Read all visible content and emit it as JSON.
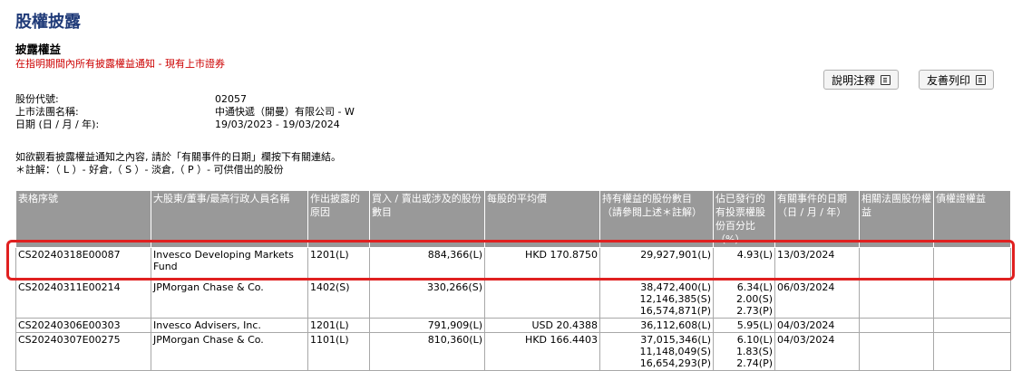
{
  "page": {
    "title": "股權披露",
    "subtitle": "披露權益",
    "notice": "在指明期間內所有披露權益通知 - 現有上市證券"
  },
  "toolbar": {
    "explain_label": "說明注釋",
    "print_label": "友善列印"
  },
  "info": [
    {
      "label": "股份代號:",
      "value": "02057"
    },
    {
      "label": "上市法團名稱:",
      "value": "中通快遞（開曼）有限公司 - W"
    },
    {
      "label": "日期 (日 / 月 / 年):",
      "value": "19/03/2023 - 19/03/2024"
    }
  ],
  "hint": {
    "line1": "如欲觀看披露權益通知之內容, 請於「有關事件的日期」欄按下有關連結。",
    "line2": "＊註解：（ L ）- 好倉,（ S ）- 淡倉,（ P ）- 可供借出的股份"
  },
  "table": {
    "headers": [
      "表格序號",
      "大股東/董事/最高行政人員名稱",
      "作出披露的原因",
      "買入 / 賣出或涉及的股份數目",
      "每股的平均價",
      "持有權益的股份數目（請參閱上述＊註解）",
      "佔已發行的有投票權股份百分比（%）",
      "有關事件的日期（日 / 月 / 年）",
      "相關法團股份權益",
      "債權證權益"
    ],
    "rows": [
      {
        "id": "CS20240318E00087",
        "name": "Invesco Developing Markets Fund",
        "reason": "1201(L)",
        "shares": "884,366(L)",
        "price": "HKD 170.8750",
        "held": [
          "29,927,901(L)"
        ],
        "pct": [
          "4.93(L)"
        ],
        "date": "13/03/2024",
        "rel": "",
        "debt": ""
      },
      {
        "id": "CS20240311E00214",
        "name": "JPMorgan Chase & Co.",
        "reason": "1402(S)",
        "shares": "330,266(S)",
        "price": "",
        "held": [
          "38,472,400(L)",
          "12,146,385(S)",
          "16,574,871(P)"
        ],
        "pct": [
          "6.34(L)",
          "2.00(S)",
          "2.73(P)"
        ],
        "date": "06/03/2024",
        "rel": "",
        "debt": ""
      },
      {
        "id": "CS20240306E00303",
        "name": "Invesco Advisers, Inc.",
        "reason": "1201(L)",
        "shares": "791,909(L)",
        "price": "USD 20.4388",
        "held": [
          "36,112,608(L)"
        ],
        "pct": [
          "5.95(L)"
        ],
        "date": "04/03/2024",
        "rel": "",
        "debt": ""
      },
      {
        "id": "CS20240307E00275",
        "name": "JPMorgan Chase & Co.",
        "reason": "1101(L)",
        "shares": "810,360(L)",
        "price": "HKD 166.4403",
        "held": [
          "37,015,346(L)",
          "11,148,049(S)",
          "16,654,293(P)"
        ],
        "pct": [
          "6.10(L)",
          "1.83(S)",
          "2.74(P)"
        ],
        "date": "04/03/2024",
        "rel": "",
        "debt": ""
      }
    ]
  },
  "colors": {
    "title": "#1f3a78",
    "notice": "#cc0000",
    "header_bg": "#999999",
    "highlight": "#e02020"
  }
}
